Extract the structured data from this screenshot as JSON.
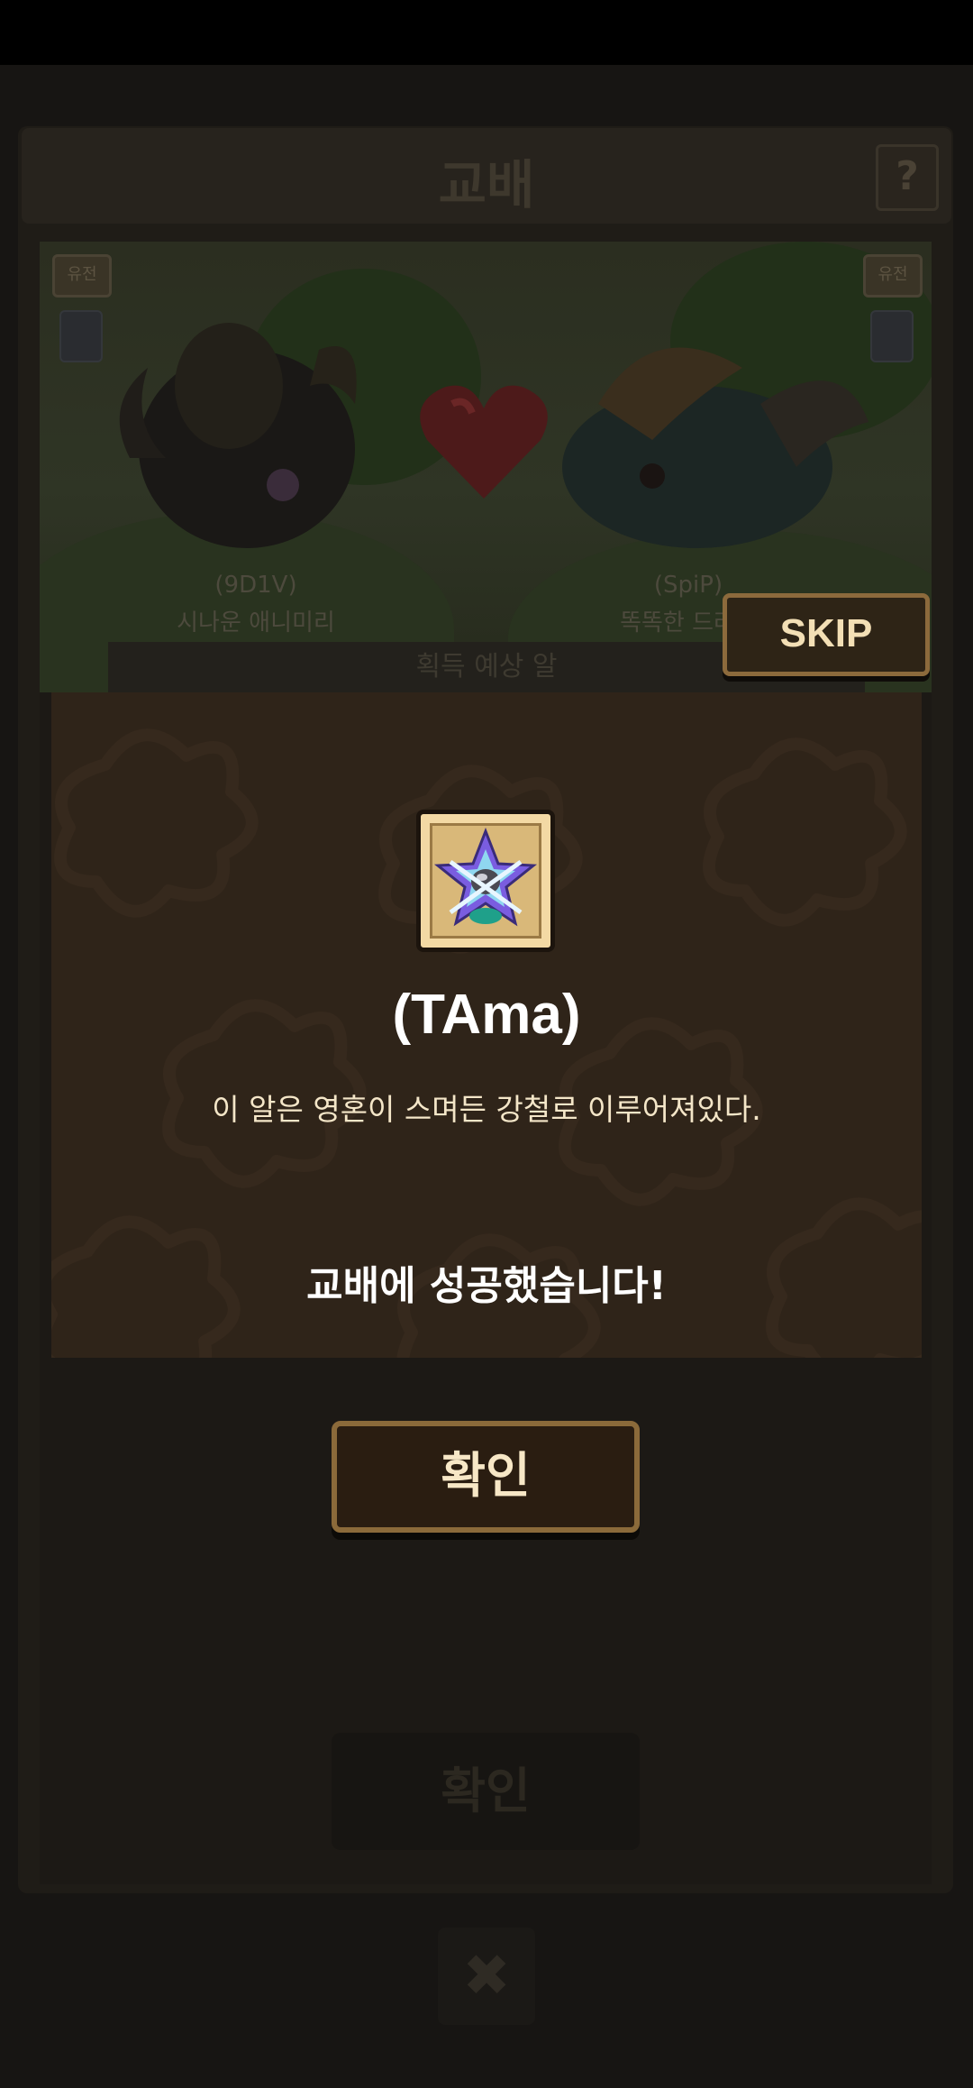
{
  "background": {
    "title": "교배",
    "help_label": "?",
    "left_pet_code": "(9D1V)",
    "left_pet_name": "시나운 애니미리",
    "right_pet_code": "(SpiP)",
    "right_pet_name": "똑똑한 드라고",
    "reward_label": "획득 예상 알",
    "corner_badge": "유전",
    "confirm_label": "확인",
    "close_icon": "✖"
  },
  "skip_label": "SKIP",
  "modal": {
    "item_icon": "steel-soul-egg-icon",
    "item_name": "(TAma)",
    "item_description": "이 알은 영혼이 스며든 강철로 이루어져있다.",
    "success_message": "교배에 성공했습니다!",
    "confirm_label": "확인"
  },
  "colors": {
    "modal_bg": "#2f2419",
    "button_border": "#8b6a3a",
    "text_light": "#f4e6c8"
  }
}
